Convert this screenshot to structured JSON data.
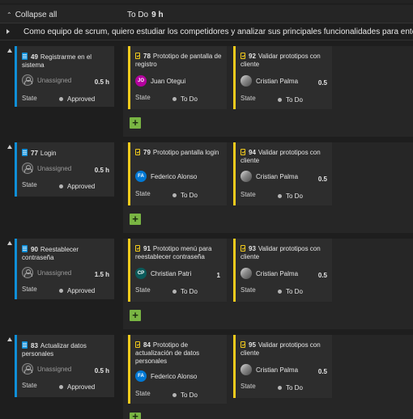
{
  "header": {
    "collapse_label": "Collapse all",
    "column_title": "To Do",
    "column_count": "9 h"
  },
  "feature": {
    "title": "Como equipo de scrum, quiero estudiar los competidores y analizar sus principales funcionalidades para entender s"
  },
  "labels": {
    "state": "State"
  },
  "rows": [
    {
      "story": {
        "id": "49",
        "title": "Registrarme en el sistema",
        "assignee": "Unassigned",
        "estimate": "0.5 h",
        "state": "Approved"
      },
      "tasks": [
        {
          "id": "78",
          "title": "Prototipo de pantalla de registro",
          "assignee": "Juan Otegui",
          "initials": "JO",
          "avatar_color": "#b4009e",
          "estimate": "",
          "state": "To Do"
        },
        {
          "id": "92",
          "title": "Validar prototipos con cliente",
          "assignee": "Cristian Palma",
          "initials": "",
          "avatar_color": "",
          "estimate": "0.5",
          "state": "To Do"
        }
      ]
    },
    {
      "story": {
        "id": "77",
        "title": "Login",
        "assignee": "Unassigned",
        "estimate": "0.5 h",
        "state": "Approved"
      },
      "tasks": [
        {
          "id": "79",
          "title": "Prototipo pantalla login",
          "assignee": "Federico Alonso",
          "initials": "FA",
          "avatar_color": "#0078d4",
          "estimate": "",
          "state": "To Do"
        },
        {
          "id": "94",
          "title": "Validar prototipos con cliente",
          "assignee": "Cristian Palma",
          "initials": "",
          "avatar_color": "",
          "estimate": "0.5",
          "state": "To Do"
        }
      ]
    },
    {
      "story": {
        "id": "90",
        "title": "Reestablecer contraseña",
        "assignee": "Unassigned",
        "estimate": "1.5 h",
        "state": "Approved"
      },
      "tasks": [
        {
          "id": "91",
          "title": "Prototipo menú para reestablecer contraseña",
          "assignee": "Christian Patri",
          "initials": "CP",
          "avatar_color": "#0b5a5a",
          "estimate": "1",
          "state": "To Do"
        },
        {
          "id": "93",
          "title": "Validar prototipos con cliente",
          "assignee": "Cristian Palma",
          "initials": "",
          "avatar_color": "",
          "estimate": "0.5",
          "state": "To Do"
        }
      ]
    },
    {
      "story": {
        "id": "83",
        "title": "Actualizar datos personales",
        "assignee": "Unassigned",
        "estimate": "0.5 h",
        "state": "Approved"
      },
      "tasks": [
        {
          "id": "84",
          "title": "Prototipo de actualización de datos personales",
          "assignee": "Federico Alonso",
          "initials": "FA",
          "avatar_color": "#0078d4",
          "estimate": "",
          "state": "To Do"
        },
        {
          "id": "95",
          "title": "Validar prototipos con cliente",
          "assignee": "Cristian Palma",
          "initials": "",
          "avatar_color": "",
          "estimate": "0.5",
          "state": "To Do"
        }
      ]
    }
  ],
  "colors": {
    "story_accent": "#0f8fd8",
    "task_accent": "#f2cb1d",
    "add_button": "#79b543",
    "background": "#1e1e1e"
  }
}
